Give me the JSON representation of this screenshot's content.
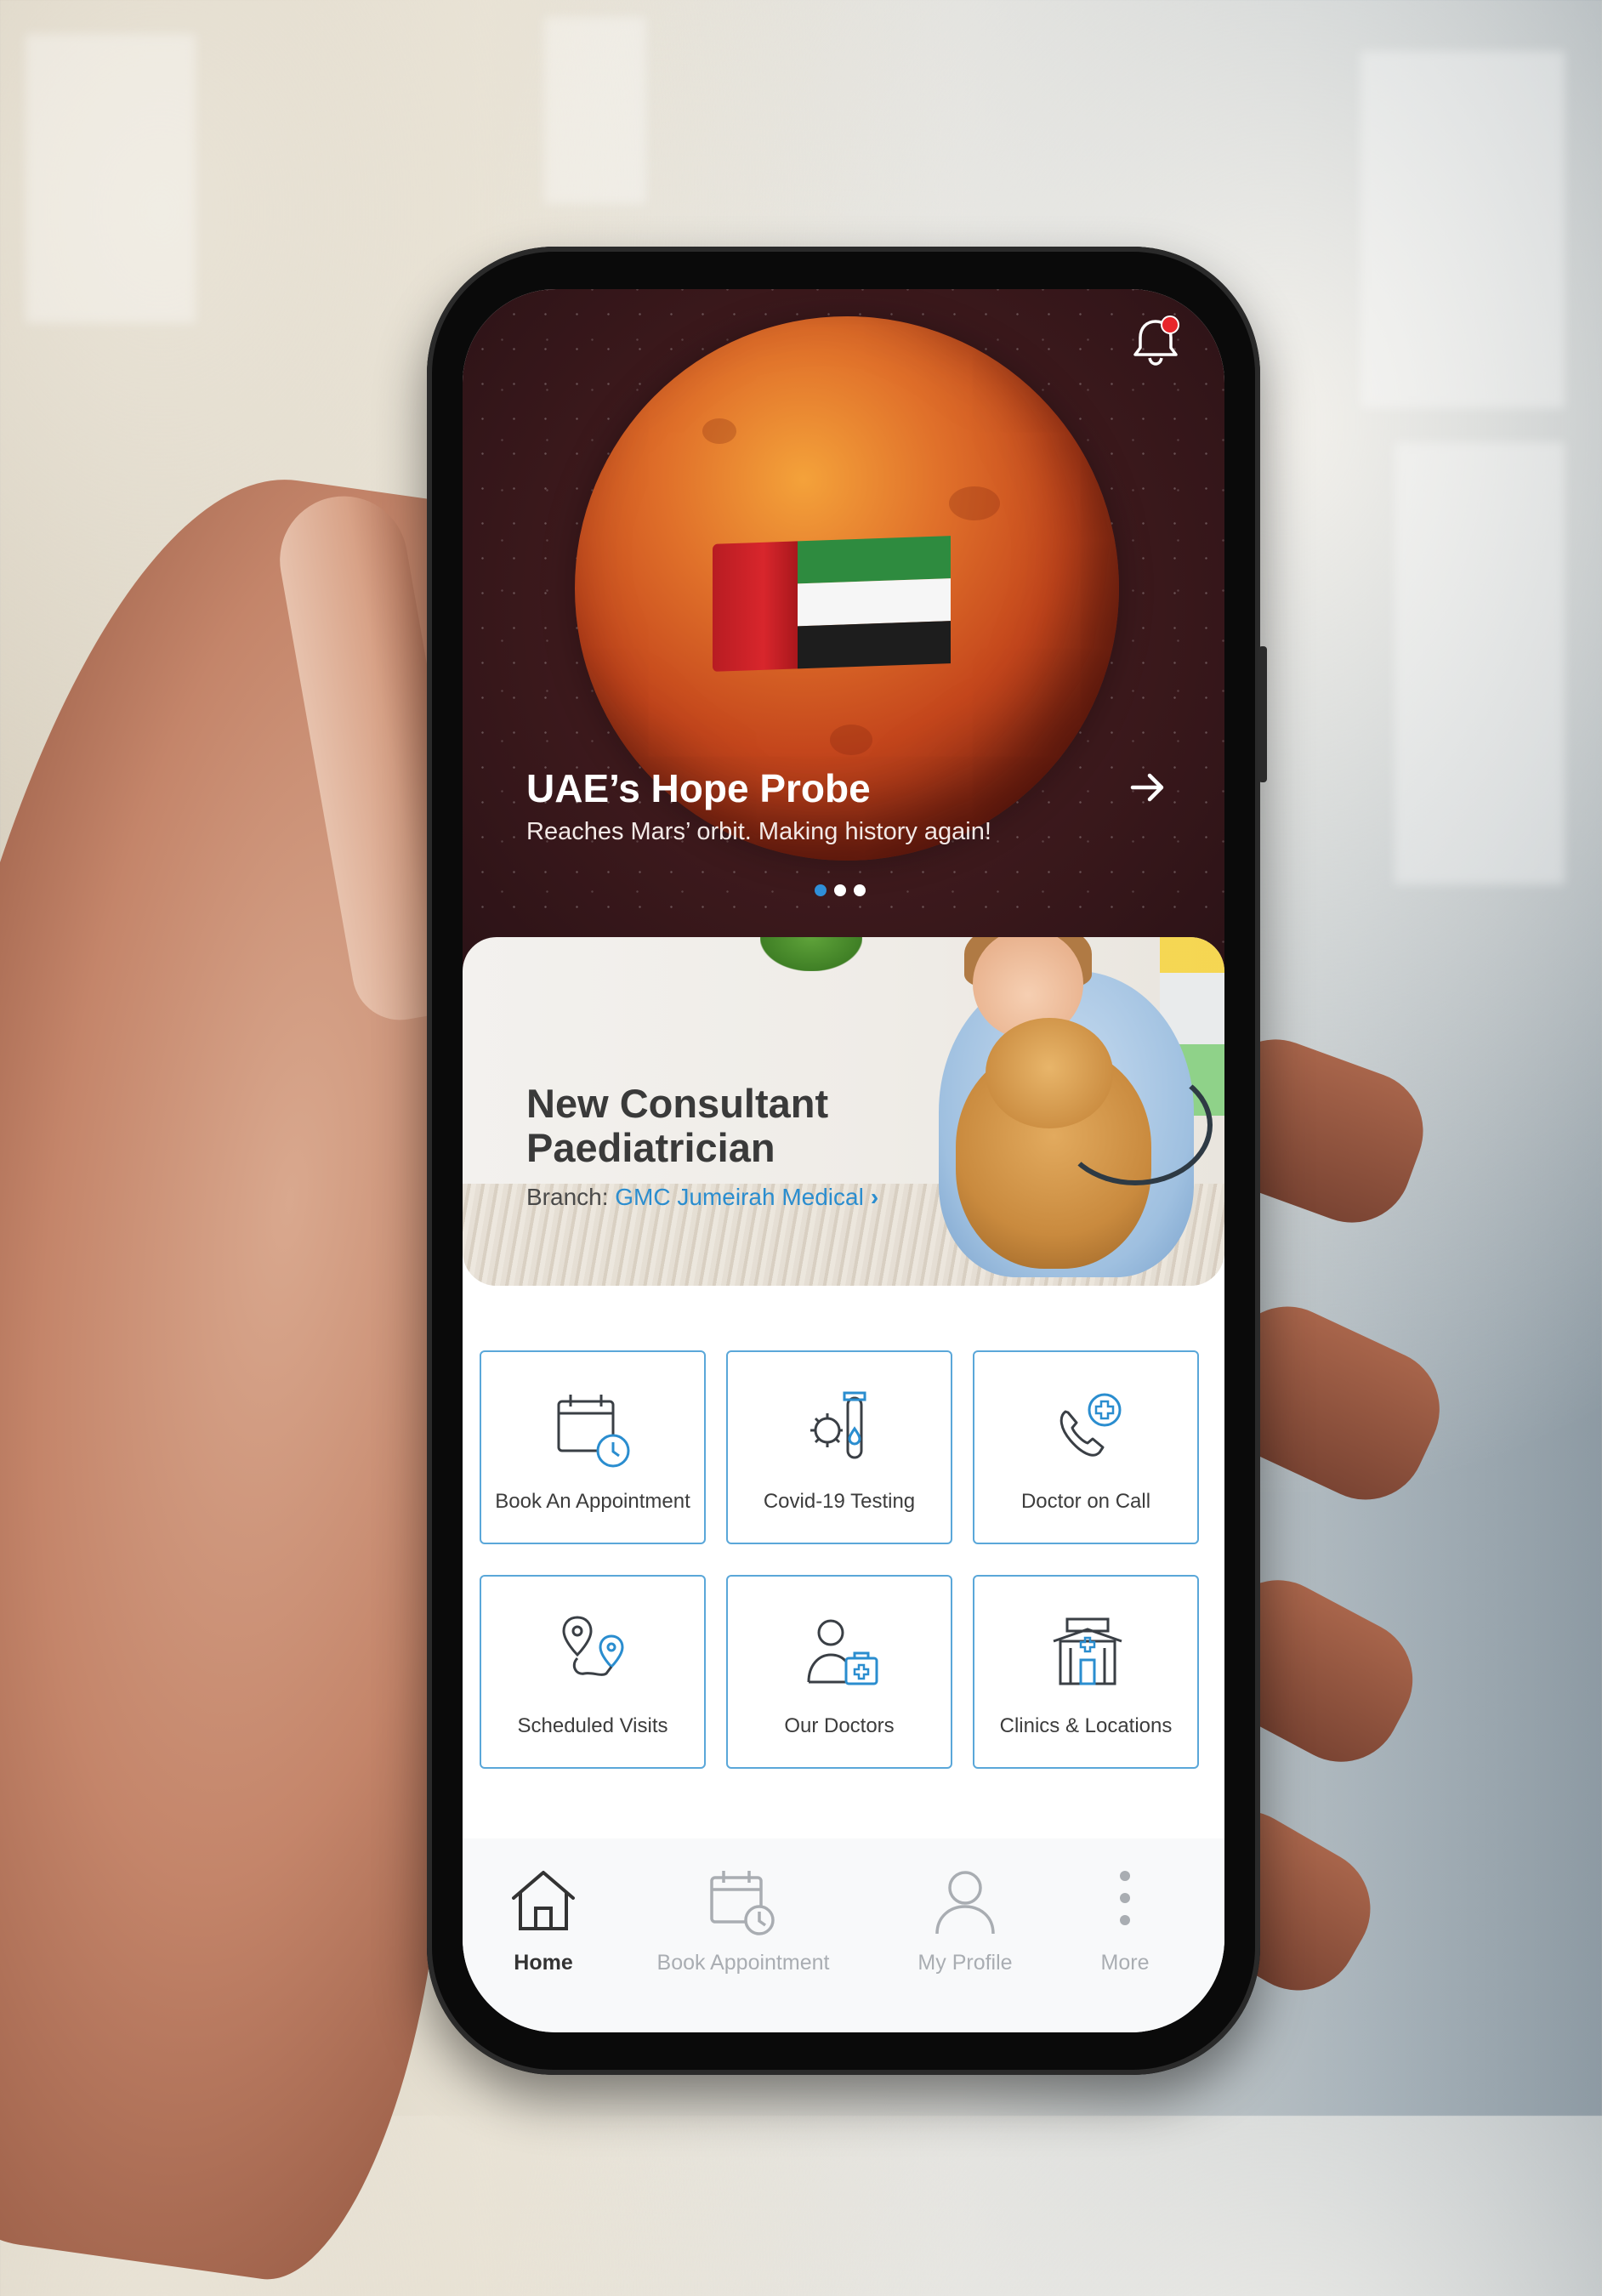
{
  "hero": {
    "title": "UAE’s Hope Probe",
    "subtitle": "Reaches Mars’ orbit. Making history again!",
    "carousel": {
      "count": 3,
      "active_index": 0
    }
  },
  "promo": {
    "title": "New Consultant Paediatrician",
    "branch_label": "Branch:",
    "branch_name": "GMC Jumeirah Medical"
  },
  "services": [
    {
      "label": "Book An Appointment",
      "icon": "calendar-clock-icon"
    },
    {
      "label": "Covid-19 Testing",
      "icon": "virus-test-tube-icon"
    },
    {
      "label": "Doctor on Call",
      "icon": "phone-medical-icon"
    },
    {
      "label": "Scheduled Visits",
      "icon": "map-route-pins-icon"
    },
    {
      "label": "Our Doctors",
      "icon": "doctor-medkit-icon"
    },
    {
      "label": "Clinics & Locations",
      "icon": "hospital-building-icon"
    }
  ],
  "bottom_nav": [
    {
      "label": "Home",
      "icon": "home-icon",
      "active": true
    },
    {
      "label": "Book Appointment",
      "icon": "calendar-clock-icon",
      "active": false
    },
    {
      "label": "My Profile",
      "icon": "user-icon",
      "active": false
    },
    {
      "label": "More",
      "icon": "more-vertical-icon",
      "active": false
    }
  ],
  "colors": {
    "accent": "#2a8dcf",
    "tile_border": "#5aa7d9",
    "notification_badge": "#e8262c"
  }
}
